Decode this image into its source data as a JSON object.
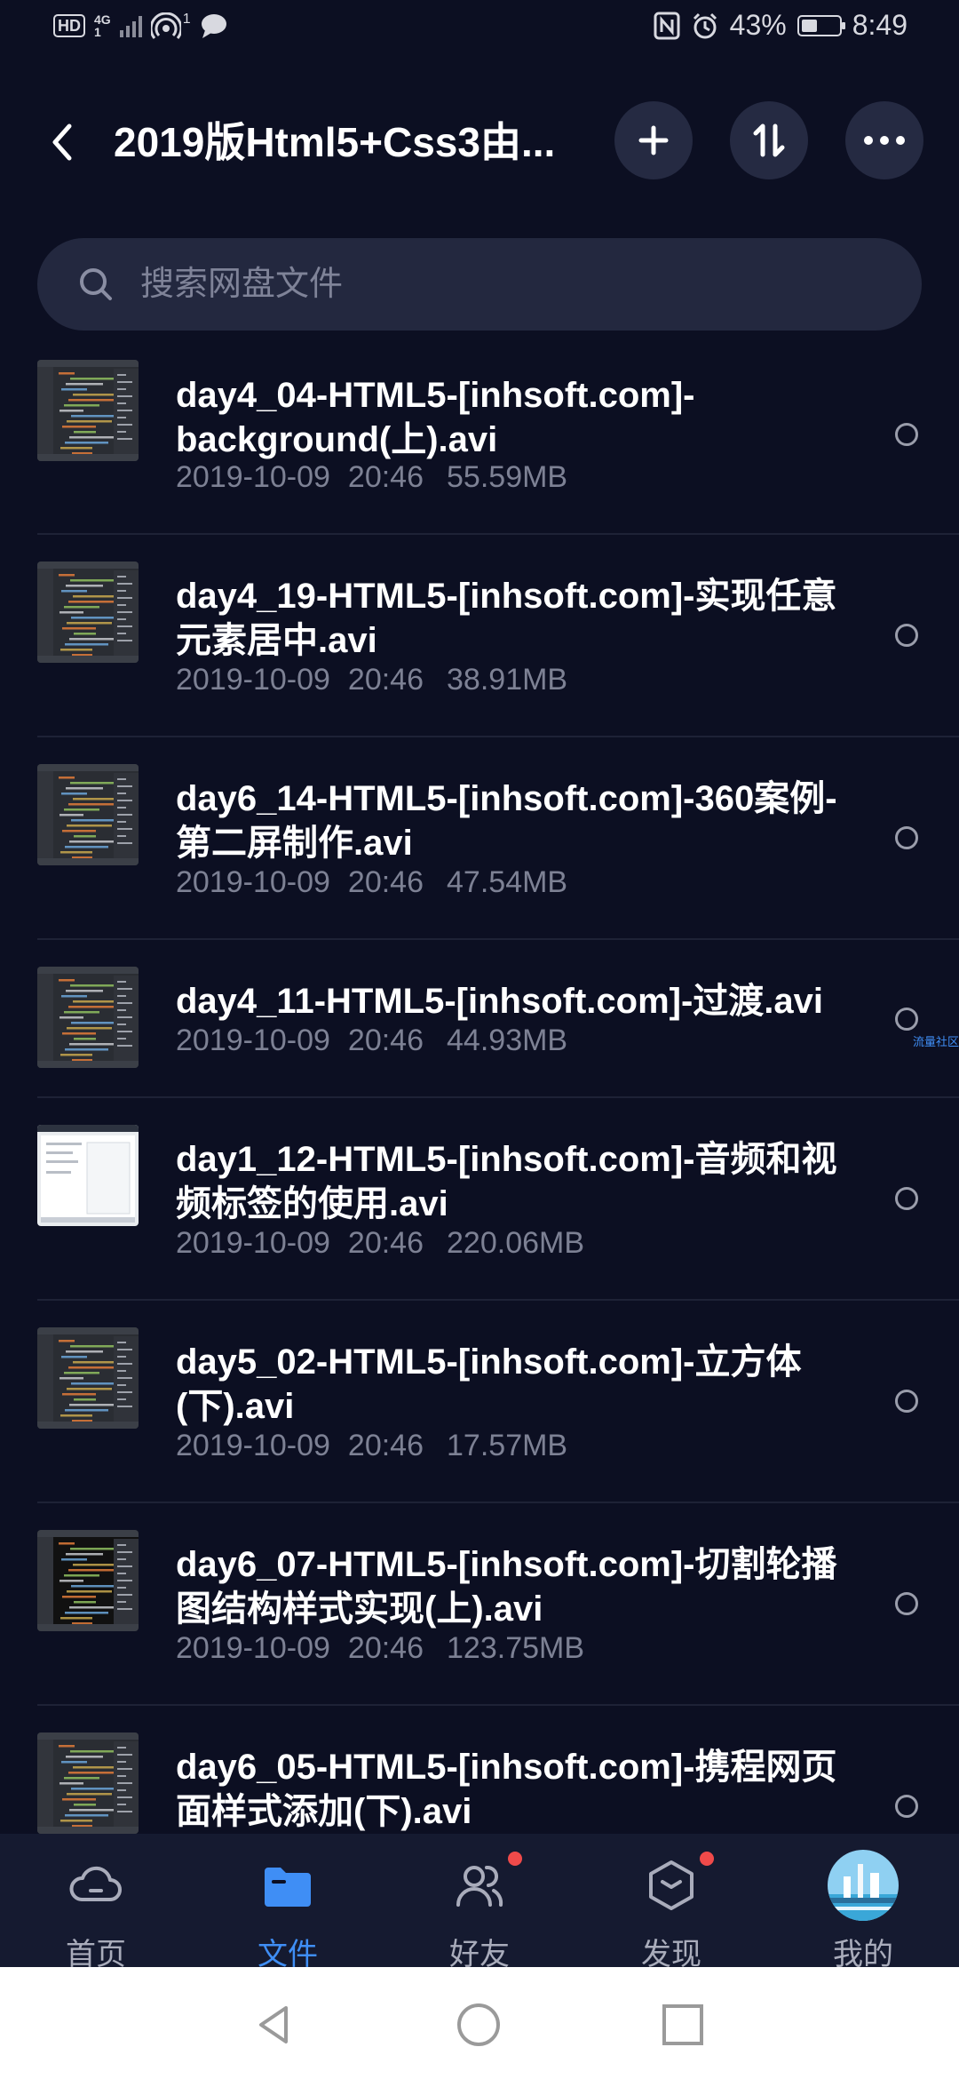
{
  "status_bar": {
    "hd": "HD",
    "network": "4G",
    "network_sub": "1",
    "hotspot_count": "1",
    "battery": "43%",
    "battery_level": 0.43,
    "time": "8:49"
  },
  "header": {
    "title": "2019版Html5+Css3由..."
  },
  "search": {
    "placeholder": "搜索网盘文件"
  },
  "files": [
    {
      "name": "day4_04-HTML5-[inhsoft.com]-background(上).avi",
      "date": "2019-10-09",
      "time": "20:46",
      "size": "55.59MB"
    },
    {
      "name": "day4_19-HTML5-[inhsoft.com]-实现任意元素居中.avi",
      "date": "2019-10-09",
      "time": "20:46",
      "size": "38.91MB"
    },
    {
      "name": "day6_14-HTML5-[inhsoft.com]-360案例-第二屏制作.avi",
      "date": "2019-10-09",
      "time": "20:46",
      "size": "47.54MB"
    },
    {
      "name": "day4_11-HTML5-[inhsoft.com]-过渡.avi",
      "date": "2019-10-09",
      "time": "20:46",
      "size": "44.93MB"
    },
    {
      "name": "day1_12-HTML5-[inhsoft.com]-音频和视频标签的使用.avi",
      "date": "2019-10-09",
      "time": "20:46",
      "size": "220.06MB"
    },
    {
      "name": "day5_02-HTML5-[inhsoft.com]-立方体(下).avi",
      "date": "2019-10-09",
      "time": "20:46",
      "size": "17.57MB"
    },
    {
      "name": "day6_07-HTML5-[inhsoft.com]-切割轮播图结构样式实现(上).avi",
      "date": "2019-10-09",
      "time": "20:46",
      "size": "123.75MB"
    },
    {
      "name": "day6_05-HTML5-[inhsoft.com]-携程网页面样式添加(下).avi",
      "date": "",
      "time": "",
      "size": ""
    }
  ],
  "float_tag": "流量社区",
  "nav": {
    "tabs": [
      {
        "label": "首页",
        "icon": "cloud-icon"
      },
      {
        "label": "文件",
        "icon": "folder-icon"
      },
      {
        "label": "好友",
        "icon": "friends-icon"
      },
      {
        "label": "发现",
        "icon": "discover-icon"
      },
      {
        "label": "我的",
        "icon": "avatar-icon"
      }
    ],
    "active_index": 1,
    "accent": "#3f8ef5"
  }
}
